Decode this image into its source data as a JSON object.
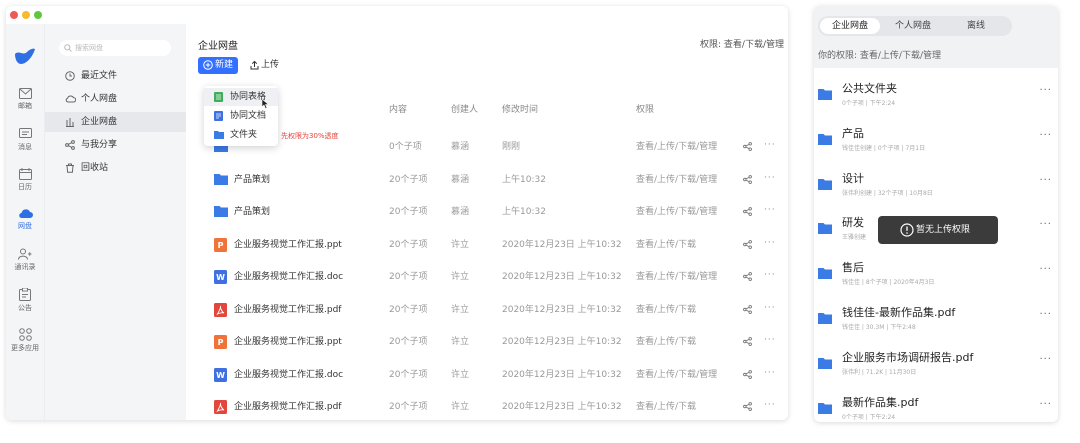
{
  "app": {
    "search_placeholder": "搜索网盘",
    "appbar": [
      "邮箱",
      "消息",
      "日历",
      "网盘",
      "通讯录",
      "公告",
      "更多应用"
    ],
    "sidebar": [
      "最近文件",
      "个人网盘",
      "企业网盘",
      "与我分享",
      "回收站"
    ]
  },
  "main": {
    "title": "企业网盘",
    "permission": "权限: 查看/下载/管理",
    "new_button": "新建",
    "upload_button": "上传",
    "columns": [
      "内容",
      "创建人",
      "修改时间",
      "权限"
    ],
    "dropdown": [
      "协同表格",
      "协同文档",
      "文件夹"
    ],
    "note": "先权限为30%透度",
    "rows": [
      {
        "name": "",
        "content": "0个子项",
        "creator": "慕涵",
        "time": "刚刚",
        "perm": "查看/上传/下载/管理"
      },
      {
        "name": "产品策划",
        "content": "20个子项",
        "creator": "慕涵",
        "time": "上午10:32",
        "perm": "查看/上传/下载/管理"
      },
      {
        "name": "产品策划",
        "content": "20个子项",
        "creator": "慕涵",
        "time": "上午10:32",
        "perm": "查看/上传/下载/管理"
      },
      {
        "name": "企业服务视觉工作汇报.ppt",
        "content": "20个子项",
        "creator": "许立",
        "time": "2020年12月23日 上午10:32",
        "perm": "查看/上传/下载"
      },
      {
        "name": "企业服务视觉工作汇报.doc",
        "content": "20个子项",
        "creator": "许立",
        "time": "2020年12月23日 上午10:32",
        "perm": "查看/上传/下载/管理"
      },
      {
        "name": "企业服务视觉工作汇报.pdf",
        "content": "20个子项",
        "creator": "许立",
        "time": "2020年12月23日 上午10:32",
        "perm": "查看/上传/下载"
      },
      {
        "name": "企业服务视觉工作汇报.ppt",
        "content": "20个子项",
        "creator": "许立",
        "time": "2020年12月23日 上午10:32",
        "perm": "查看/上传/下载"
      },
      {
        "name": "企业服务视觉工作汇报.doc",
        "content": "20个子项",
        "creator": "许立",
        "time": "2020年12月23日 上午10:32",
        "perm": "查看/上传/下载/管理"
      },
      {
        "name": "企业服务视觉工作汇报.pdf",
        "content": "20个子项",
        "creator": "许立",
        "time": "2020年12月23日 上午10:32",
        "perm": "查看/上传/下载"
      }
    ],
    "row_types": [
      "folder",
      "folder",
      "folder",
      "ppt",
      "doc",
      "pdf",
      "ppt",
      "doc",
      "pdf"
    ]
  },
  "panel": {
    "tabs": [
      "企业网盘",
      "个人网盘",
      "离线"
    ],
    "permission": "你的权限: 查看/上传/下载/管理",
    "toast": "暂无上传权限",
    "items": [
      {
        "title": "公共文件夹",
        "sub": "0个子项 | 下午2:24"
      },
      {
        "title": "产品",
        "sub": "钱佳佳创建 | 0个子项 | 7月1日"
      },
      {
        "title": "设计",
        "sub": "张伟利创建 | 32个子项 | 10月8日"
      },
      {
        "title": "研发",
        "sub": "王雅创建"
      },
      {
        "title": "售后",
        "sub": "钱佳佳 | 8个子项 | 2020年4月3日"
      },
      {
        "title": "钱佳佳-最新作品集.pdf",
        "sub": "钱佳佳 | 30.3M | 下午2:48"
      },
      {
        "title": "企业服务市场调研报告.pdf",
        "sub": "张伟利 | 71.2K | 11月30日"
      },
      {
        "title": "最新作品集.pdf",
        "sub": "0个子项 | 下午2:24"
      }
    ]
  },
  "colors": {
    "accent": "#3370ff",
    "folder": "#3a7be6",
    "ppt": "#f0743a",
    "doc": "#3f6fe0",
    "pdf": "#e2473d"
  },
  "icons": [
    "search-icon",
    "mail-icon",
    "message-icon",
    "calendar-icon",
    "cloud-icon",
    "contacts-icon",
    "notice-icon",
    "apps-icon",
    "clock-icon",
    "cloud-outline-icon",
    "building-icon",
    "share-icon",
    "trash-icon",
    "plus-circle-icon",
    "upload-icon",
    "sheet-icon",
    "doc-icon",
    "folder-icon",
    "ppt-icon",
    "pdf-icon",
    "more-icon",
    "info-icon",
    "cursor-icon"
  ]
}
